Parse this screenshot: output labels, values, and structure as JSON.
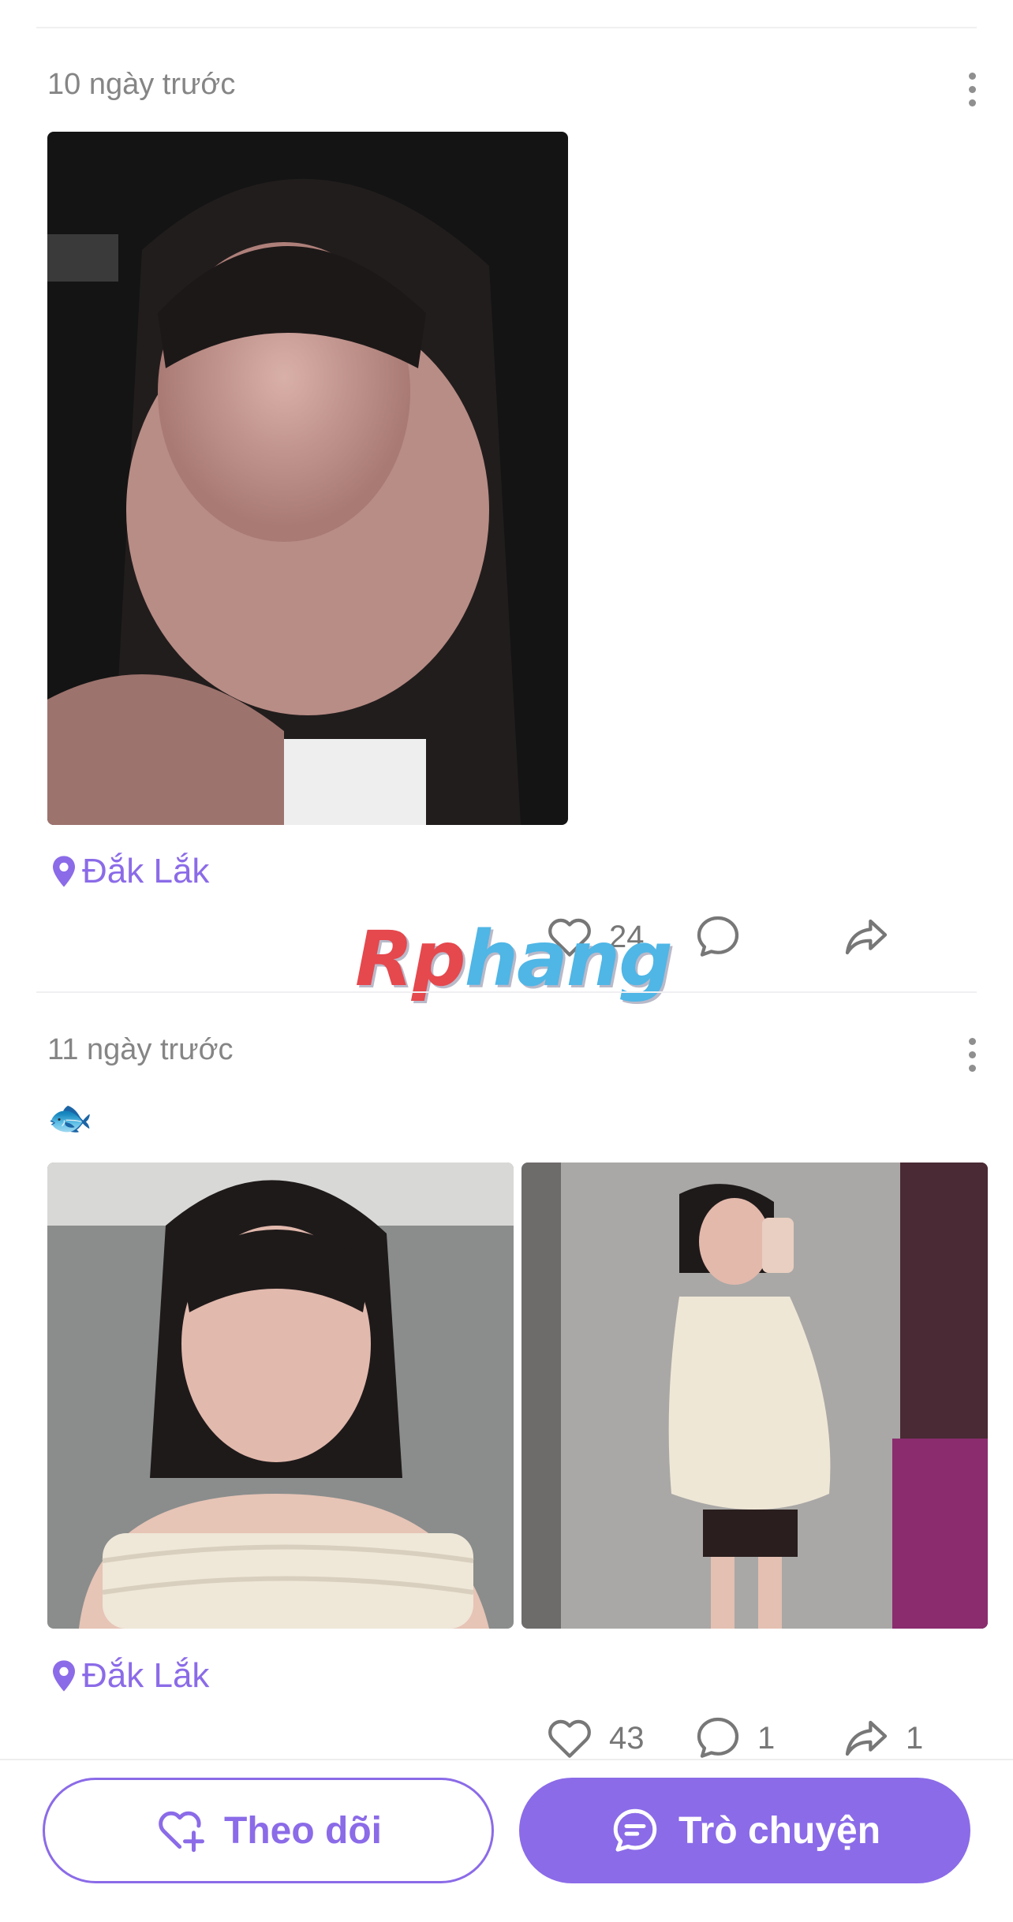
{
  "posts": [
    {
      "time": "10 ngày trước",
      "location": "Đắk Lắk",
      "likes": "24",
      "comments": "",
      "shares": ""
    },
    {
      "time": "11 ngày trước",
      "emoji": "🐟",
      "location": "Đắk Lắk",
      "likes": "43",
      "comments": "1",
      "shares": "1"
    }
  ],
  "watermark": {
    "part1": "Rp",
    "part2": "hang"
  },
  "bottom_bar": {
    "follow_label": "Theo dõi",
    "chat_label": "Trò chuyện"
  },
  "colors": {
    "accent": "#8b6be8",
    "icon_gray": "#777777"
  },
  "icons": [
    "location-pin-icon",
    "heart-icon",
    "comment-icon",
    "share-icon",
    "more-icon",
    "heart-plus-icon",
    "chat-icon"
  ]
}
